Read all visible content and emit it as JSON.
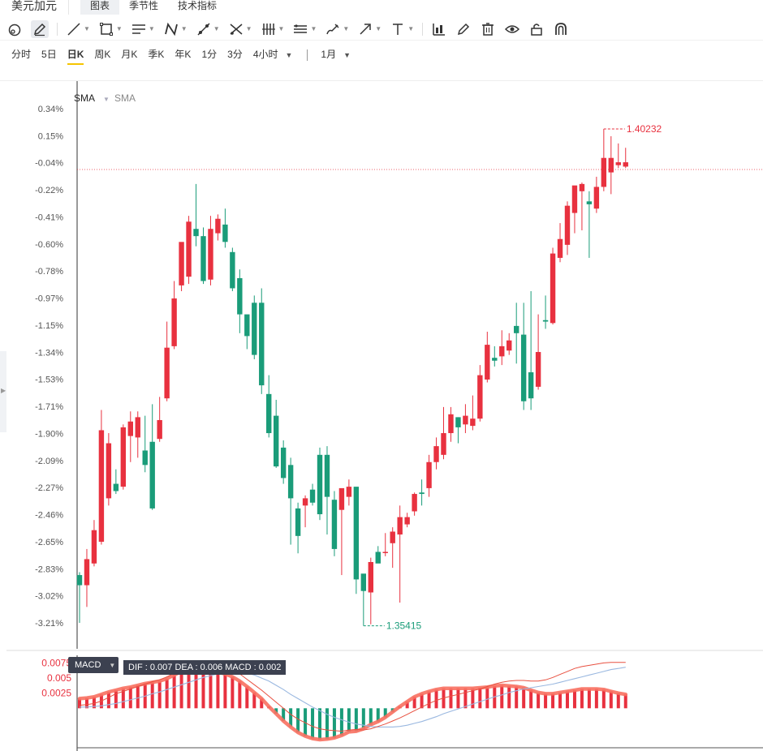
{
  "app_title": "美元加元",
  "tabs": [
    {
      "label": "图表",
      "active": true
    },
    {
      "label": "季节性",
      "active": false
    },
    {
      "label": "技术指标",
      "active": false
    }
  ],
  "toolbar": {
    "tools": [
      "crosshair-icon",
      "pencil-icon",
      "trendline-icon",
      "rectangle-icon",
      "parallel-lines-icon",
      "pattern-icon",
      "measure-icon",
      "fibonacci-icon",
      "gann-icon",
      "channel-icon",
      "brush-icon",
      "arrow-icon",
      "text-icon",
      "chart-bars-icon",
      "edit-icon",
      "trash-icon",
      "eye-icon",
      "lock-icon",
      "magnet-icon"
    ]
  },
  "periods": {
    "items": [
      "分时",
      "5日",
      "日K",
      "周K",
      "月K",
      "季K",
      "年K",
      "1分",
      "3分",
      "4小时"
    ],
    "active": "日K",
    "range": "1月"
  },
  "legend": {
    "sma_1": "SMA",
    "sma_2": "SMA"
  },
  "macd": {
    "label": "MACD",
    "values_text": "DIF : 0.007  DEA : 0.006  MACD : 0.002",
    "ticks": [
      "0.0075",
      "0.005",
      "0.0025"
    ]
  },
  "colors": {
    "up": "#e8313f",
    "down": "#1a9c79",
    "macd_line": "#f87060",
    "dea_line": "#9ab8e0"
  },
  "chart_data": {
    "type": "candlestick",
    "y_axis_labels": [
      "0.34%",
      "0.15%",
      "-0.04%",
      "-0.22%",
      "-0.41%",
      "-0.60%",
      "-0.78%",
      "-0.97%",
      "-1.15%",
      "-1.34%",
      "-1.53%",
      "-1.71%",
      "-1.90%",
      "-2.09%",
      "-2.27%",
      "-2.46%",
      "-2.65%",
      "-2.83%",
      "-3.02%",
      "-3.21%"
    ],
    "ylim": [
      -3.25,
      0.45
    ],
    "ref_level": -0.08,
    "high_label": "1.40232",
    "low_label": "1.35415",
    "candles": [
      [
        -2.88,
        -2.95,
        -2.86,
        -3.21
      ],
      [
        -2.95,
        -2.77,
        -2.7,
        -3.1
      ],
      [
        -2.8,
        -2.57,
        -2.5,
        -2.82
      ],
      [
        -2.65,
        -1.88,
        -1.74,
        -2.67
      ],
      [
        -2.35,
        -1.97,
        -1.9,
        -2.4
      ],
      [
        -2.25,
        -2.3,
        -2.15,
        -2.32
      ],
      [
        -2.27,
        -1.86,
        -1.84,
        -2.29
      ],
      [
        -1.92,
        -1.82,
        -1.75,
        -2.1
      ],
      [
        -1.93,
        -1.79,
        -1.75,
        -2.07
      ],
      [
        -2.02,
        -2.12,
        -1.78,
        -2.17
      ],
      [
        -1.96,
        -2.42,
        -1.7,
        -2.43
      ],
      [
        -1.94,
        -1.81,
        -1.65,
        -1.96
      ],
      [
        -1.66,
        -1.31,
        -1.13,
        -1.68
      ],
      [
        -1.3,
        -0.97,
        -0.85,
        -1.32
      ],
      [
        -0.88,
        -0.58,
        -0.6,
        -0.92
      ],
      [
        -0.82,
        -0.44,
        -0.4,
        -0.87
      ],
      [
        -0.49,
        -0.54,
        -0.18,
        -0.61
      ],
      [
        -0.54,
        -0.85,
        -0.48,
        -0.87
      ],
      [
        -0.84,
        -0.49,
        -0.4,
        -0.88
      ],
      [
        -0.52,
        -0.42,
        -0.39,
        -0.57
      ],
      [
        -0.46,
        -0.58,
        -0.35,
        -0.62
      ],
      [
        -0.65,
        -0.9,
        -0.62,
        -0.92
      ],
      [
        -0.83,
        -1.08,
        -0.77,
        -1.21
      ],
      [
        -1.08,
        -1.23,
        -1.12,
        -1.32
      ],
      [
        -1.0,
        -1.36,
        -0.95,
        -1.39
      ],
      [
        -1.0,
        -1.57,
        -0.9,
        -1.63
      ],
      [
        -1.63,
        -1.9,
        -1.5,
        -1.93
      ],
      [
        -1.78,
        -2.13,
        -1.67,
        -2.14
      ],
      [
        -2.0,
        -2.21,
        -1.95,
        -2.25
      ],
      [
        -2.12,
        -2.35,
        -2.07,
        -2.67
      ],
      [
        -2.42,
        -2.61,
        -2.38,
        -2.73
      ],
      [
        -2.4,
        -2.35,
        -2.33,
        -2.55
      ],
      [
        -2.29,
        -2.38,
        -2.25,
        -2.4
      ],
      [
        -2.05,
        -2.46,
        -2.0,
        -2.5
      ],
      [
        -2.05,
        -2.34,
        -1.99,
        -2.6
      ],
      [
        -2.36,
        -2.7,
        -2.3,
        -2.75
      ],
      [
        -2.43,
        -2.28,
        -2.3,
        -2.88
      ],
      [
        -2.34,
        -2.27,
        -2.22,
        -2.4
      ],
      [
        -2.27,
        -2.91,
        -2.33,
        -3.01
      ],
      [
        -2.87,
        -2.99,
        -2.89,
        -3.23
      ],
      [
        -3.0,
        -2.79,
        -2.76,
        -3.22
      ],
      [
        -2.72,
        -2.8,
        -2.68,
        -2.77
      ],
      [
        -2.72,
        -2.72,
        -2.59,
        -2.75
      ],
      [
        -2.66,
        -2.58,
        -2.55,
        -2.83
      ],
      [
        -2.6,
        -2.48,
        -2.4,
        -3.07
      ],
      [
        -2.53,
        -2.48,
        -2.45,
        -2.55
      ],
      [
        -2.44,
        -2.32,
        -2.31,
        -2.47
      ],
      [
        -2.31,
        -2.32,
        -2.22,
        -2.4
      ],
      [
        -2.28,
        -2.1,
        -2.05,
        -2.34
      ],
      [
        -2.1,
        -1.99,
        -1.93,
        -2.15
      ],
      [
        -2.05,
        -1.9,
        -1.72,
        -2.08
      ],
      [
        -1.9,
        -1.77,
        -1.72,
        -1.96
      ],
      [
        -1.79,
        -1.86,
        -1.79,
        -1.97
      ],
      [
        -1.84,
        -1.78,
        -1.7,
        -1.9
      ],
      [
        -1.85,
        -1.8,
        -1.64,
        -1.88
      ],
      [
        -1.8,
        -1.5,
        -1.43,
        -1.82
      ],
      [
        -1.53,
        -1.29,
        -1.2,
        -1.55
      ],
      [
        -1.38,
        -1.4,
        -1.3,
        -1.44
      ],
      [
        -1.37,
        -1.3,
        -1.19,
        -1.43
      ],
      [
        -1.33,
        -1.26,
        -1.21,
        -1.36
      ],
      [
        -1.16,
        -1.21,
        -1.0,
        -1.42
      ],
      [
        -1.22,
        -1.68,
        -1.0,
        -1.74
      ],
      [
        -1.48,
        -1.66,
        -0.92,
        -1.74
      ],
      [
        -1.58,
        -1.34,
        -1.08,
        -1.6
      ],
      [
        -1.12,
        -1.13,
        -0.95,
        -1.18
      ],
      [
        -1.14,
        -0.66,
        -0.62,
        -1.15
      ],
      [
        -0.69,
        -0.56,
        -0.45,
        -0.72
      ],
      [
        -0.6,
        -0.33,
        -0.3,
        -0.67
      ],
      [
        -0.38,
        -0.19,
        -0.22,
        -0.52
      ],
      [
        -0.23,
        -0.18,
        -0.17,
        -0.5
      ],
      [
        -0.3,
        -0.32,
        -0.23,
        -0.69
      ],
      [
        -0.35,
        -0.2,
        -0.13,
        -0.38
      ],
      [
        -0.2,
        0.0,
        0.2,
        -0.23
      ],
      [
        -0.1,
        0.0,
        0.15,
        -0.25
      ],
      [
        -0.05,
        -0.03,
        0.1,
        -0.07
      ],
      [
        -0.06,
        -0.03,
        0.07,
        -0.07
      ]
    ],
    "macd_hist": [
      0.0016,
      0.0017,
      0.0019,
      0.0023,
      0.0027,
      0.003,
      0.0033,
      0.0035,
      0.0038,
      0.0041,
      0.0043,
      0.0045,
      0.0049,
      0.0055,
      0.0061,
      0.0066,
      0.0068,
      0.0066,
      0.0063,
      0.006,
      0.0057,
      0.0052,
      0.0045,
      0.0036,
      0.0026,
      0.0016,
      0.0003,
      -0.0009,
      -0.0021,
      -0.0031,
      -0.004,
      -0.0046,
      -0.005,
      -0.0052,
      -0.0051,
      -0.0049,
      -0.0045,
      -0.0039,
      -0.0038,
      -0.0034,
      -0.0027,
      -0.0022,
      -0.0015,
      -0.0006,
      0.0003,
      0.0011,
      0.0019,
      0.0024,
      0.0028,
      0.0031,
      0.0033,
      0.0033,
      0.0033,
      0.0033,
      0.0033,
      0.0034,
      0.0035,
      0.0037,
      0.0038,
      0.0037,
      0.0036,
      0.0034,
      0.003,
      0.0026,
      0.0024,
      0.0024,
      0.0026,
      0.0028,
      0.003,
      0.0032,
      0.0032,
      0.0032,
      0.0031,
      0.0028,
      0.0025,
      0.0023
    ],
    "dif": [
      0.0005,
      0.0006,
      0.0008,
      0.0012,
      0.0018,
      0.0024,
      0.0028,
      0.0032,
      0.0036,
      0.004,
      0.0044,
      0.0047,
      0.0052,
      0.0058,
      0.0064,
      0.007,
      0.0074,
      0.0075,
      0.0074,
      0.0072,
      0.0069,
      0.0064,
      0.0057,
      0.0048,
      0.0039,
      0.003,
      0.002,
      0.001,
      0.0,
      -0.001,
      -0.0018,
      -0.0024,
      -0.003,
      -0.0034,
      -0.0036,
      -0.0037,
      -0.0038,
      -0.0036,
      -0.0035,
      -0.0036,
      -0.0034,
      -0.003,
      -0.0026,
      -0.0021,
      -0.0016,
      -0.001,
      -0.0004,
      0.0002,
      0.0008,
      0.0013,
      0.0017,
      0.002,
      0.0023,
      0.0026,
      0.0029,
      0.0032,
      0.0036,
      0.004,
      0.0043,
      0.0045,
      0.0046,
      0.0046,
      0.0045,
      0.0045,
      0.0047,
      0.0051,
      0.0056,
      0.0061,
      0.0066,
      0.0069,
      0.0071,
      0.0073,
      0.0075,
      0.0076,
      0.0076,
      0.0076
    ],
    "dea": [
      0.0002,
      0.0002,
      0.0003,
      0.0004,
      0.0006,
      0.0008,
      0.0011,
      0.0014,
      0.0017,
      0.002,
      0.0024,
      0.0027,
      0.0031,
      0.0035,
      0.0039,
      0.0043,
      0.0047,
      0.0051,
      0.0054,
      0.0057,
      0.0059,
      0.006,
      0.006,
      0.0058,
      0.0055,
      0.005,
      0.0045,
      0.0038,
      0.0031,
      0.0023,
      0.0016,
      0.0009,
      0.0002,
      -0.0004,
      -0.001,
      -0.0015,
      -0.0019,
      -0.0023,
      -0.0026,
      -0.0028,
      -0.003,
      -0.0031,
      -0.0031,
      -0.0031,
      -0.003,
      -0.0028,
      -0.0025,
      -0.0022,
      -0.0018,
      -0.0014,
      -0.0009,
      -0.0005,
      -0.0001,
      0.0003,
      0.0007,
      0.0011,
      0.0015,
      0.0019,
      0.0022,
      0.0026,
      0.0029,
      0.0032,
      0.0034,
      0.0036,
      0.0038,
      0.004,
      0.0043,
      0.0046,
      0.0049,
      0.0052,
      0.0055,
      0.0058,
      0.0061,
      0.0064,
      0.0066,
      0.0068
    ],
    "macd_ylim": [
      -0.006,
      0.0085
    ]
  }
}
